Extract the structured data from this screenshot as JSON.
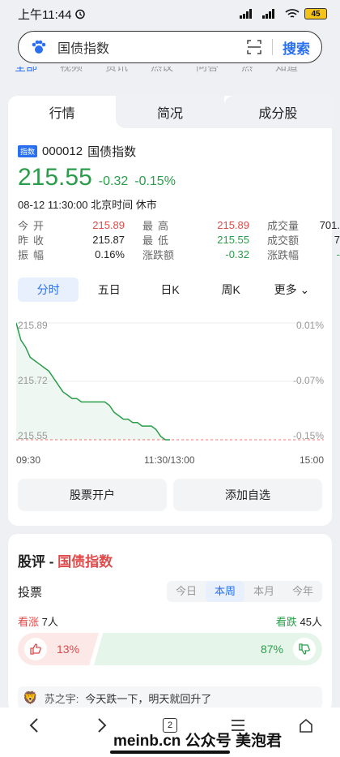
{
  "status": {
    "time": "上午11:44",
    "battery": "45"
  },
  "search": {
    "query": "国债指数",
    "button": "搜索"
  },
  "top_tabs": [
    "全部",
    "视频",
    "资讯",
    "热议",
    "问答",
    "热",
    "知道"
  ],
  "seg_tabs": [
    "行情",
    "简况",
    "成分股"
  ],
  "quote": {
    "badge": "指数",
    "code": "000012",
    "name": "国债指数",
    "price": "215.55",
    "change": "-0.32",
    "change_pct": "-0.15%",
    "time": "08-12 11:30:00",
    "tz": "北京时间",
    "state": "休市"
  },
  "stats": [
    {
      "l1": "今开",
      "v1": "215.89",
      "c1": "red",
      "l2": "最高",
      "v2": "215.89",
      "c2": "red",
      "l3": "成交量",
      "v3": "701."
    },
    {
      "l1": "昨收",
      "v1": "215.87",
      "c1": "",
      "l2": "最低",
      "v2": "215.55",
      "c2": "green",
      "l3": "成交额",
      "v3": "7"
    },
    {
      "l1": "振幅",
      "v1": "0.16%",
      "c1": "",
      "l2": "涨跌额",
      "v2": "-0.32",
      "c2": "green",
      "l3": "涨跌幅",
      "v3": "-"
    }
  ],
  "period_tabs": [
    "分时",
    "五日",
    "日K",
    "周K",
    "更多"
  ],
  "chart_data": {
    "type": "line",
    "y_ticks": [
      "215.89",
      "215.72",
      "215.55"
    ],
    "y_pct_ticks": [
      "0.01%",
      "-0.07%",
      "-0.15%"
    ],
    "x_ticks": [
      "09:30",
      "11:30/13:00",
      "15:00"
    ],
    "ylim": [
      215.55,
      215.89
    ],
    "series": [
      {
        "values": [
          215.89,
          215.84,
          215.82,
          215.79,
          215.78,
          215.77,
          215.76,
          215.75,
          215.73,
          215.71,
          215.69,
          215.68,
          215.67,
          215.67,
          215.66,
          215.66,
          215.66,
          215.66,
          215.66,
          215.66,
          215.65,
          215.63,
          215.62,
          215.61,
          215.61,
          215.6,
          215.6,
          215.59,
          215.59,
          215.59,
          215.58,
          215.56,
          215.55,
          215.55
        ]
      }
    ]
  },
  "actions": [
    "股票开户",
    "添加自选"
  ],
  "review": {
    "title_prefix": "股评 -",
    "title_name": "国债指数",
    "vote_label": "投票",
    "vote_tabs": [
      "今日",
      "本周",
      "本月",
      "今年"
    ],
    "up_label": "看涨",
    "up_count": "7人",
    "down_label": "看跌",
    "down_count": "45人",
    "up_pct": "13%",
    "down_pct": "87%",
    "comment_user": "苏之宇:",
    "comment_text": "今天跌一下，明天就回升了"
  },
  "nav": {
    "tabs_count": "2"
  },
  "watermark": "meinb.cn 公众号 美泡君"
}
